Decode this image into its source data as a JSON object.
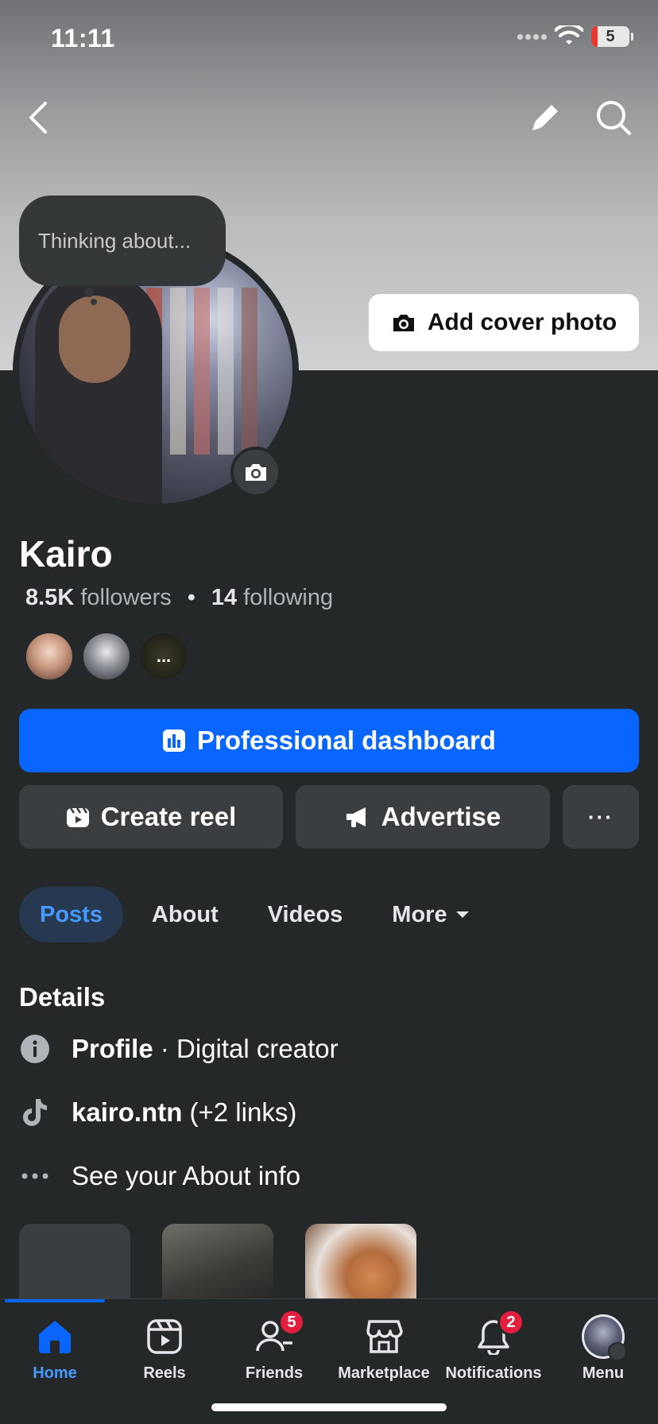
{
  "status_bar": {
    "time": "11:11",
    "battery": "5"
  },
  "header": {
    "back_icon": "chevron-left-icon",
    "edit_icon": "pencil-icon",
    "search_icon": "search-icon"
  },
  "thought_bubble": {
    "text": "Thinking about..."
  },
  "cover": {
    "add_cover_label": "Add cover photo"
  },
  "profile": {
    "name": "Kairo",
    "followers_count": "8.5K",
    "followers_label": "followers",
    "separator": "•",
    "following_count": "14",
    "following_label": "following",
    "friend_more": "..."
  },
  "actions": {
    "primary_label": "Professional dashboard",
    "create_reel_label": "Create reel",
    "advertise_label": "Advertise",
    "more_label": "···"
  },
  "tabs": [
    {
      "label": "Posts",
      "active": true
    },
    {
      "label": "About"
    },
    {
      "label": "Videos"
    },
    {
      "label": "More"
    }
  ],
  "details": {
    "title": "Details",
    "rows": [
      {
        "bold": "Profile",
        "text": " · Digital creator",
        "icon": "info-icon"
      },
      {
        "bold": "kairo.ntn",
        "text": " (+2 links)",
        "icon": "tiktok-icon"
      },
      {
        "bold": "",
        "text": "See your About info",
        "icon": "more-dots-icon"
      }
    ]
  },
  "bottom_nav": [
    {
      "label": "Home",
      "icon": "home-icon",
      "active": true
    },
    {
      "label": "Reels",
      "icon": "reels-icon"
    },
    {
      "label": "Friends",
      "icon": "friends-icon",
      "badge": "5"
    },
    {
      "label": "Marketplace",
      "icon": "marketplace-icon"
    },
    {
      "label": "Notifications",
      "icon": "bell-icon",
      "badge": "2"
    },
    {
      "label": "Menu",
      "icon": "menu-avatar"
    }
  ],
  "colors": {
    "accent": "#0866ff",
    "background": "#242829",
    "badge": "#e41e3f",
    "active_tab_text": "#4599ff"
  }
}
